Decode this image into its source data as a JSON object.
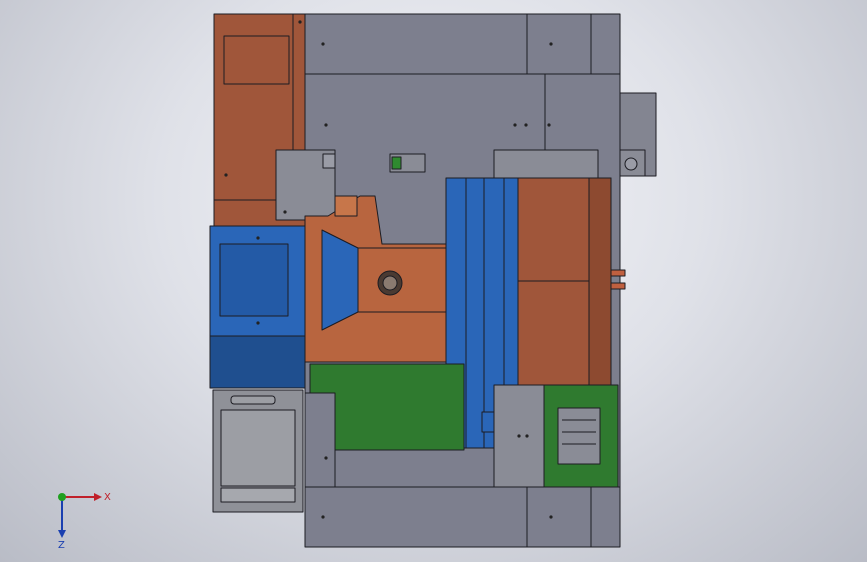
{
  "viewport": {
    "background_colors": [
      "#f4f5f9",
      "#b9bcc6"
    ],
    "part_colors": {
      "frame_gray": "#7d7f8e",
      "copper": "#a0563a",
      "copper_light": "#b8653f",
      "blue": "#2a66b8",
      "blue_dark": "#1f4f8f",
      "green": "#2f7a2f",
      "light_gray": "#9a9ca2",
      "outline": "#1c1c22"
    }
  },
  "triad": {
    "x_label": "X",
    "z_label": "Z",
    "x_color": "#c0202a",
    "y_color": "#1fa01f",
    "z_color": "#1a3fb0"
  }
}
